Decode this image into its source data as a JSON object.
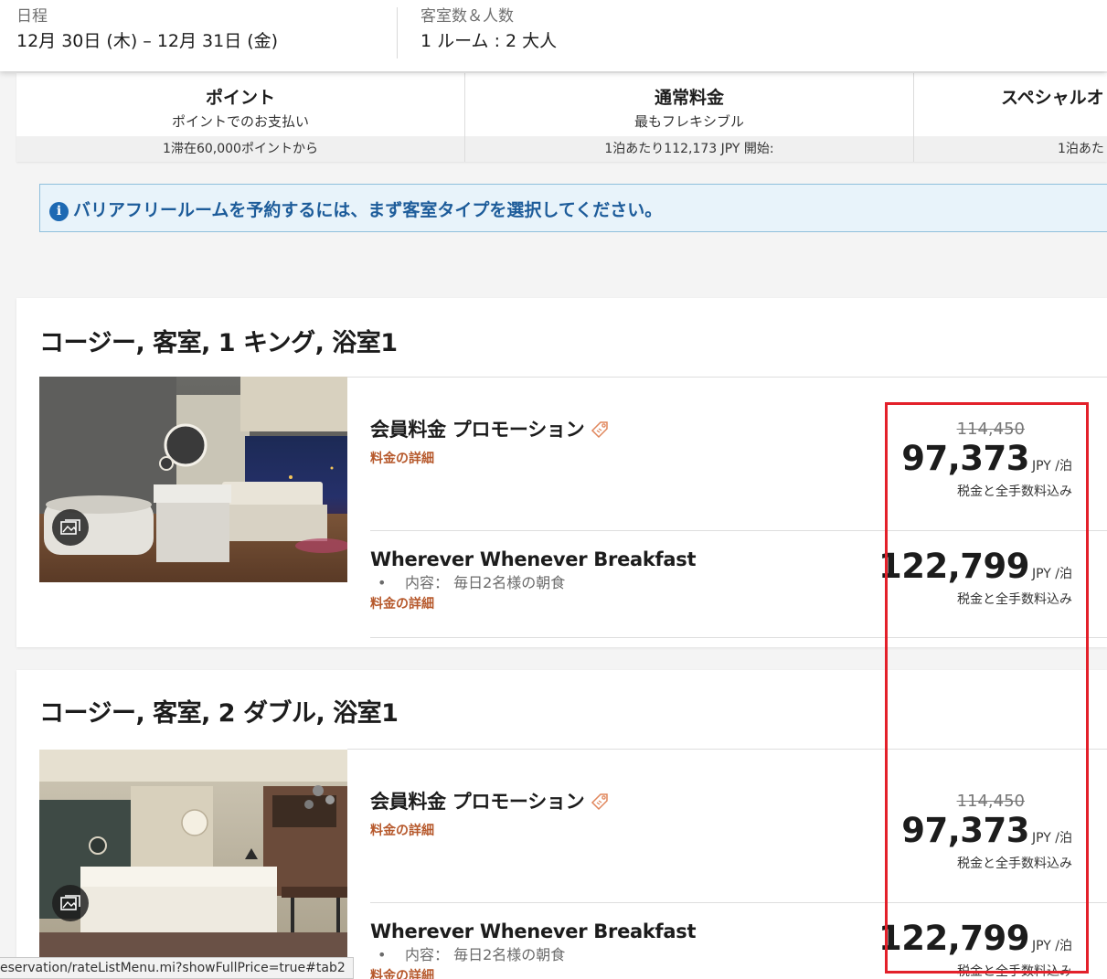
{
  "search_bar": {
    "dates_label": "日程",
    "dates_value": "12月 30日 (木) – 12月 31日 (金)",
    "rooms_label": "客室数＆人数",
    "rooms_value": "1 ルーム : 2 大人"
  },
  "rate_tabs": [
    {
      "title": "ポイント",
      "subtitle": "ポイントでのお支払い",
      "footer": "1滞在60,000ポイントから"
    },
    {
      "title": "通常料金",
      "subtitle": "最もフレキシブル",
      "footer": "1泊あたり112,173 JPY 開始:"
    },
    {
      "title": "スペシャルオ",
      "subtitle": "",
      "footer": "1泊あた"
    }
  ],
  "info_banner": {
    "icon": "info-icon",
    "text": "バリアフリールームを予約するには、まず客室タイプを選択してください。"
  },
  "rooms": [
    {
      "title": "コージー, 客室, 1 キング, 浴室1",
      "photo_icon": "gallery-icon",
      "rates": [
        {
          "name": "会員料金 プロモーション",
          "tag_icon": "tag-icon",
          "details_link": "料金の詳細",
          "original_price": "114,450",
          "price": "97,373",
          "unit": "JPY /泊",
          "note": "税金と全手数料込み"
        },
        {
          "name": "Wherever Whenever Breakfast",
          "bullet": "内容： 毎日2名様の朝食",
          "details_link": "料金の詳細",
          "price": "122,799",
          "unit": "JPY /泊",
          "note": "税金と全手数料込み"
        }
      ]
    },
    {
      "title": "コージー, 客室, 2 ダブル, 浴室1",
      "photo_icon": "gallery-icon",
      "rates": [
        {
          "name": "会員料金 プロモーション",
          "tag_icon": "tag-icon",
          "details_link": "料金の詳細",
          "original_price": "114,450",
          "price": "97,373",
          "unit": "JPY /泊",
          "note": "税金と全手数料込み"
        },
        {
          "name": "Wherever Whenever Breakfast",
          "bullet": "内容： 毎日2名様の朝食",
          "details_link": "料金の詳細",
          "price": "122,799",
          "unit": "JPY /泊",
          "note": "税金と全手数料込み"
        }
      ]
    }
  ],
  "status_bar": {
    "url": "eservation/rateListMenu.mi?showFullPrice=true#tab2"
  },
  "colors": {
    "accent_link": "#b6582b",
    "info_blue": "#1d69b3",
    "highlight_red": "#e3202a"
  }
}
